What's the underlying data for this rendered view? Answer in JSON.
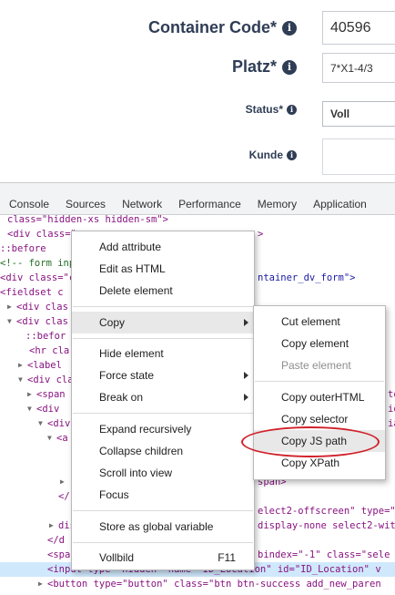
{
  "form": {
    "container_code": {
      "label": "Container Code",
      "required": "*",
      "value": "40596"
    },
    "platz": {
      "label": "Platz",
      "required": "*",
      "value": "7*X1-4/3"
    },
    "status": {
      "label": "Status",
      "required": "*",
      "value": "Voll"
    },
    "kunde": {
      "label": "Kunde"
    }
  },
  "devtools": {
    "tabs": [
      "Console",
      "Sources",
      "Network",
      "Performance",
      "Memory",
      "Application"
    ],
    "lines": [
      {
        "text": "class=\"hidden-xs hidden-sm\">"
      },
      {
        "text": "<div class=\"row"
      },
      {
        "text": "::before"
      },
      {
        "text": "<!-- form inp"
      },
      {
        "text": "<div class=\"c"
      },
      {
        "text": "<fieldset c"
      },
      {
        "text": "<div clas"
      },
      {
        "text": "<div clas"
      },
      {
        "text": "::befor"
      },
      {
        "text": "<hr cla"
      },
      {
        "text": "<label"
      },
      {
        "text": "<div cla"
      },
      {
        "text": "<span"
      },
      {
        "text": "<div"
      },
      {
        "text": "<div"
      },
      {
        "text": "<a"
      },
      {
        "text": "span>"
      },
      {
        "text": "</"
      },
      {
        "text": "elect2-offscreen\" type=\""
      },
      {
        "text": "display-none select2-wit"
      },
      {
        "text": "</d"
      },
      {
        "text": "<spa"
      },
      {
        "text": "<input type=\"hidden\" name=\"ID_Location\" id=\"ID_Location\" v"
      },
      {
        "text": "<button type=\"button\" class=\"btn btn-success add_new_paren"
      }
    ],
    "right_fragments": {
      "row_end": ">",
      "form_end": "ntainer_dv_form\">",
      "tabindex": "bindex=\"-1\" class=\"sele",
      "to": "to",
      "io": "io",
      "ia": "ia"
    }
  },
  "context_menu": {
    "items": [
      {
        "label": "Add attribute"
      },
      {
        "label": "Edit as HTML"
      },
      {
        "label": "Delete element"
      },
      {
        "label": "Copy"
      },
      {
        "label": "Hide element"
      },
      {
        "label": "Force state"
      },
      {
        "label": "Break on"
      },
      {
        "label": "Expand recursively"
      },
      {
        "label": "Collapse children"
      },
      {
        "label": "Scroll into view"
      },
      {
        "label": "Focus"
      },
      {
        "label": "Store as global variable"
      },
      {
        "label": "Vollbild",
        "shortcut": "F11"
      }
    ]
  },
  "copy_submenu": {
    "items": [
      {
        "label": "Cut element"
      },
      {
        "label": "Copy element"
      },
      {
        "label": "Paste element",
        "disabled": true
      },
      {
        "label": "Copy outerHTML"
      },
      {
        "label": "Copy selector"
      },
      {
        "label": "Copy JS path",
        "highlighted": true
      },
      {
        "label": "Copy XPath"
      }
    ]
  },
  "colors": {
    "label": "#2f3d55",
    "highlight_ring": "#d0222b",
    "menu_hover": "#e8e8e8",
    "selected_line": "#cfe8fc"
  }
}
